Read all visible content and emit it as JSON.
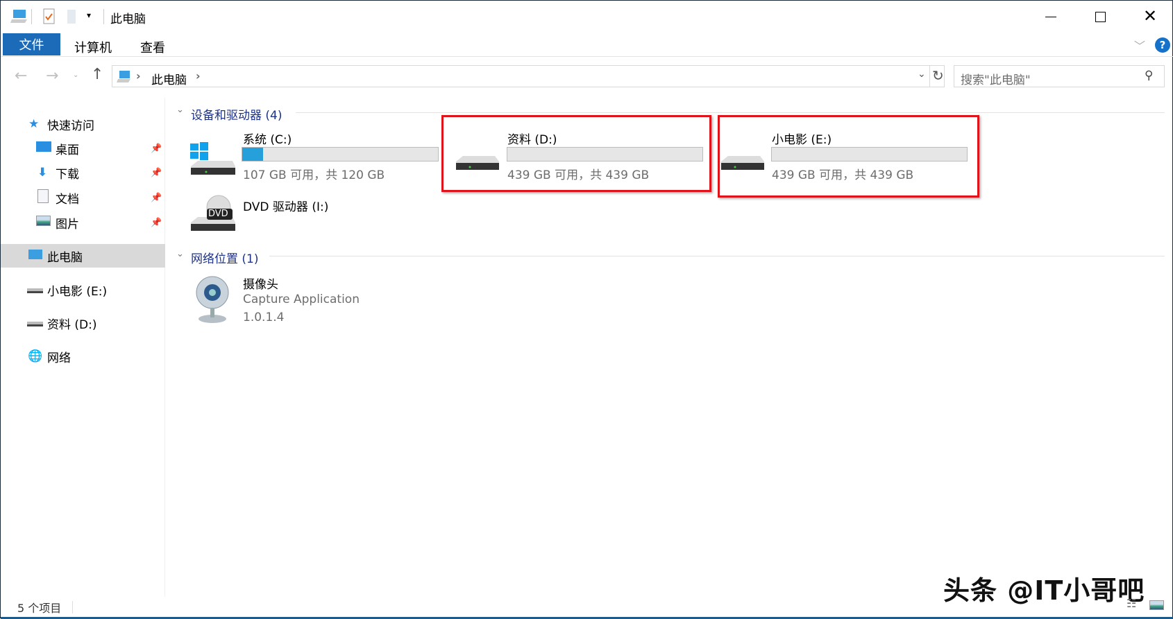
{
  "window": {
    "title": "此电脑"
  },
  "ribbon": {
    "tabs": [
      "文件",
      "计算机",
      "查看"
    ]
  },
  "address": {
    "crumb": "此电脑",
    "search_placeholder": "搜索\"此电脑\""
  },
  "sidebar": {
    "items": [
      {
        "label": "快速访问"
      },
      {
        "label": "桌面"
      },
      {
        "label": "下载"
      },
      {
        "label": "文档"
      },
      {
        "label": "图片"
      },
      {
        "label": "此电脑"
      },
      {
        "label": "小电影 (E:)"
      },
      {
        "label": "资料 (D:)"
      },
      {
        "label": "网络"
      }
    ]
  },
  "groups": {
    "devices": {
      "header": "设备和驱动器 (4)"
    },
    "network": {
      "header": "网络位置 (1)"
    }
  },
  "drives": [
    {
      "name": "系统 (C:)",
      "info": "107 GB 可用，共 120 GB",
      "used_fraction": 0.108
    },
    {
      "name": "资料 (D:)",
      "info": "439 GB 可用，共 439 GB",
      "used_fraction": 0.0
    },
    {
      "name": "小电影 (E:)",
      "info": "439 GB 可用，共 439 GB",
      "used_fraction": 0.0
    },
    {
      "name": "DVD 驱动器 (I:)",
      "icon_label": "DVD"
    }
  ],
  "network_items": [
    {
      "name": "摄像头",
      "desc": "Capture Application",
      "version": "1.0.1.4"
    }
  ],
  "status": {
    "count": "5 个项目"
  },
  "watermark": "头条 @IT小哥吧",
  "colors": {
    "accent": "#1c6bb8",
    "highlight": "#e0131b",
    "bar": "#26a0da"
  }
}
